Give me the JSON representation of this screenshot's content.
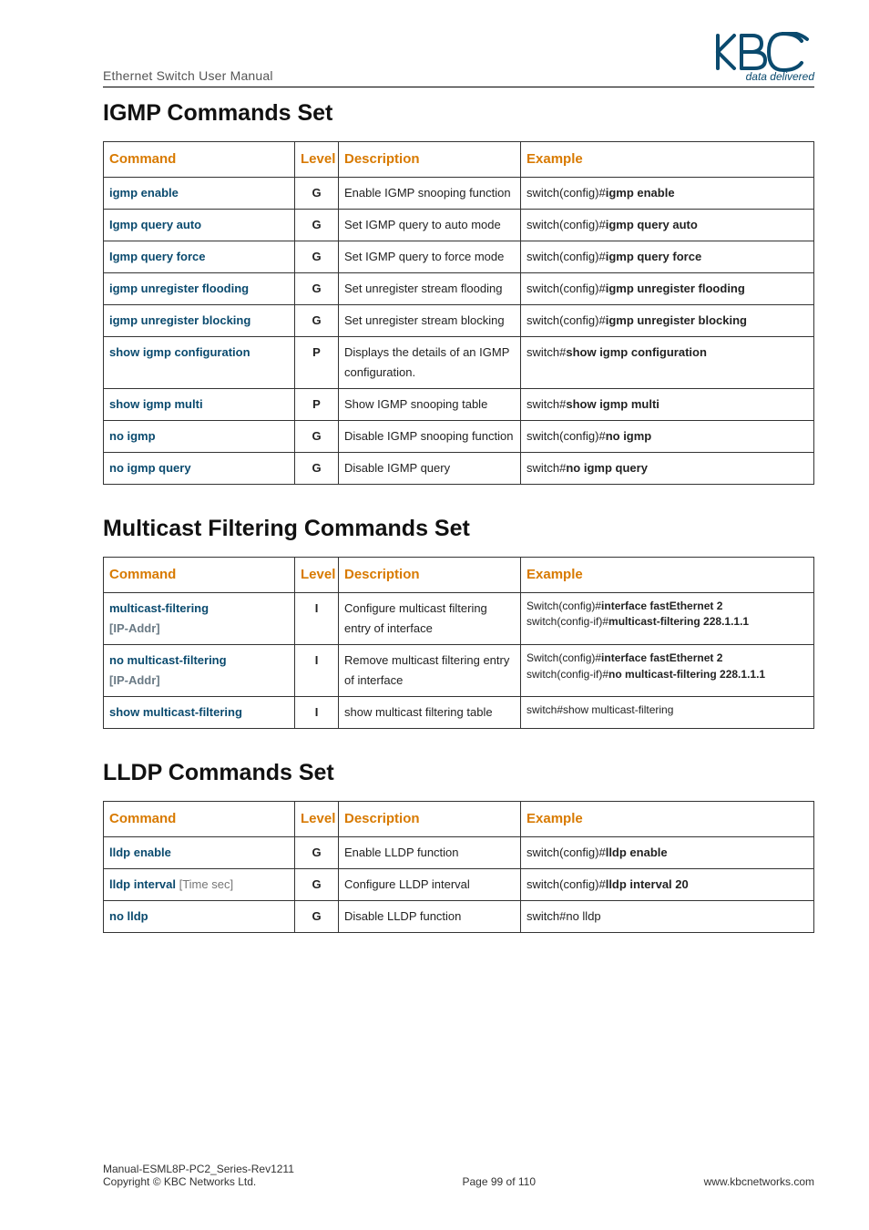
{
  "header": {
    "title": "Ethernet Switch User Manual",
    "logo_tag": "data delivered"
  },
  "sections": {
    "igmp": {
      "heading": "IGMP Commands Set",
      "cols": [
        "Command",
        "Level",
        "Description",
        "Example"
      ],
      "rows": [
        {
          "cmd": "igmp enable",
          "param": "",
          "level": "G",
          "desc": "Enable IGMP snooping function",
          "ex_pre": "switch(config)#",
          "ex_bold": "igmp enable"
        },
        {
          "cmd": "Igmp query auto",
          "param": "",
          "level": "G",
          "desc": "Set IGMP query to auto mode",
          "ex_pre": "switch(config)#",
          "ex_bold": "igmp query auto"
        },
        {
          "cmd": "Igmp query force",
          "param": "",
          "level": "G",
          "desc": "Set IGMP query to force mode",
          "ex_pre": "switch(config)#",
          "ex_bold": "igmp query force"
        },
        {
          "cmd": "igmp unregister flooding",
          "param": "",
          "level": "G",
          "desc": "Set unregister stream flooding",
          "ex_pre": "switch(config)#",
          "ex_bold": "igmp unregister flooding"
        },
        {
          "cmd": "igmp unregister blocking",
          "param": "",
          "level": "G",
          "desc": "Set unregister stream blocking",
          "ex_pre": "switch(config)#",
          "ex_bold": "igmp unregister blocking"
        },
        {
          "cmd": "show igmp configuration",
          "param": "",
          "level": "P",
          "desc": "Displays the details of an IGMP configuration.",
          "ex_pre": "switch#",
          "ex_bold": "show igmp configuration"
        },
        {
          "cmd": "show igmp multi",
          "param": "",
          "level": "P",
          "desc": "Show IGMP snooping table",
          "ex_pre": "switch#",
          "ex_bold": "show igmp multi"
        },
        {
          "cmd": "no igmp",
          "param": "",
          "level": "G",
          "desc": "Disable IGMP snooping function",
          "ex_pre": "switch(config)#",
          "ex_bold": "no igmp"
        },
        {
          "cmd": "no igmp query",
          "param": "",
          "level": "G",
          "desc": "Disable IGMP query",
          "ex_pre": "switch#",
          "ex_bold": "no igmp query"
        }
      ]
    },
    "mcast": {
      "heading": "Multicast Filtering Commands Set",
      "cols": [
        "Command",
        "Level",
        "Description",
        "Example"
      ],
      "rows": [
        {
          "cmd": "multicast-filtering",
          "param": " [IP-Addr]",
          "level": "I",
          "desc": "Configure multicast filtering entry of interface",
          "ex_lines": [
            {
              "pre": "Switch(config)#",
              "bold": "interface fastEthernet 2"
            },
            {
              "pre": "switch(config-if)#",
              "bold": "multicast-filtering 228.1.1.1"
            }
          ]
        },
        {
          "cmd": "no multicast-filtering",
          "param": " [IP-Addr]",
          "level": "I",
          "desc": "Remove multicast filtering entry of interface",
          "ex_lines": [
            {
              "pre": "Switch(config)#",
              "bold": "interface fastEthernet 2"
            },
            {
              "pre": "switch(config-if)#",
              "bold": "no multicast-filtering 228.1.1.1"
            }
          ]
        },
        {
          "cmd": "show multicast-filtering",
          "param": "",
          "level": "I",
          "desc": "show multicast filtering table",
          "ex_lines": [
            {
              "pre": "switch#show multicast-filtering",
              "bold": ""
            }
          ]
        }
      ]
    },
    "lldp": {
      "heading": "LLDP Commands Set",
      "cols": [
        "Command",
        "Level",
        "Description",
        "Example"
      ],
      "rows": [
        {
          "cmd": "lldp enable",
          "param": "",
          "level": "G",
          "desc": "Enable LLDP function",
          "ex_pre": "switch(config)#",
          "ex_bold": "lldp enable"
        },
        {
          "cmd": "lldp interval",
          "param": " [Time sec]",
          "level": "G",
          "desc": "Configure LLDP interval",
          "ex_pre": "switch(config)#",
          "ex_bold": "lldp interval 20"
        },
        {
          "cmd": "no lldp",
          "param": "",
          "level": "G",
          "desc": "Disable LLDP function",
          "ex_pre": "switch#no lldp",
          "ex_bold": ""
        }
      ]
    }
  },
  "footer": {
    "left1": "Manual-ESML8P-PC2_Series-Rev1211",
    "left2": "Copyright © KBC Networks Ltd.",
    "center": "Page 99 of 110",
    "right": "www.kbcnetworks.com"
  }
}
